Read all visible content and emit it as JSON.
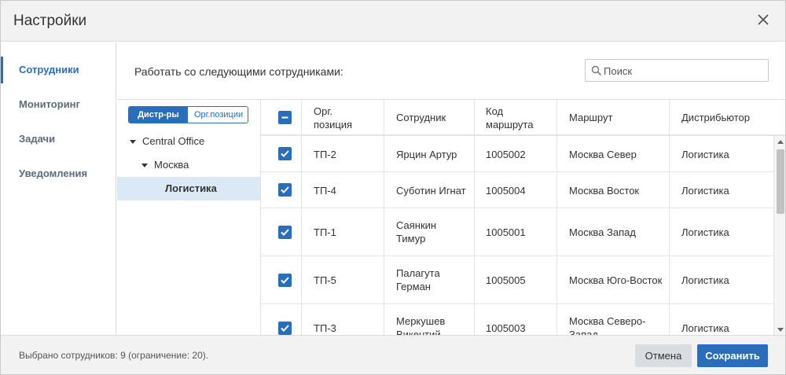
{
  "header": {
    "title": "Настройки"
  },
  "sidebar": {
    "items": [
      {
        "label": "Сотрудники",
        "active": true
      },
      {
        "label": "Мониторинг",
        "active": false
      },
      {
        "label": "Задачи",
        "active": false
      },
      {
        "label": "Уведомления",
        "active": false
      }
    ]
  },
  "main": {
    "prompt": "Работать со следующими сотрудниками:",
    "search": {
      "placeholder": "Поиск",
      "value": ""
    }
  },
  "tree": {
    "toggle": {
      "active_label": "Дистр-ры",
      "inactive_label": "Орг.позиции"
    },
    "nodes": [
      {
        "label": "Central Office"
      },
      {
        "label": "Москва"
      },
      {
        "label": "Логистика"
      }
    ]
  },
  "grid": {
    "columns": {
      "position": "Орг. позиция",
      "employee": "Сотрудник",
      "route_code": "Код маршрута",
      "route": "Маршрут",
      "distributor": "Дистрибьютор"
    },
    "rows": [
      {
        "checked": true,
        "position": "ТП-2",
        "employee": "Ярцин Артур",
        "route_code": "1005002",
        "route": "Москва Север",
        "distributor": "Логистика"
      },
      {
        "checked": true,
        "position": "ТП-4",
        "employee": "Суботин Игнат",
        "route_code": "1005004",
        "route": "Москва Восток",
        "distributor": "Логистика"
      },
      {
        "checked": true,
        "position": "ТП-1",
        "employee": "Саянкин Тимур",
        "route_code": "1005001",
        "route": "Москва Запад",
        "distributor": "Логистика"
      },
      {
        "checked": true,
        "position": "ТП-5",
        "employee": "Палагута Герман",
        "route_code": "1005005",
        "route": "Москва Юго-Восток",
        "distributor": "Логистика"
      },
      {
        "checked": true,
        "position": "ТП-3",
        "employee": "Меркушев Викентий",
        "route_code": "1005003",
        "route": "Москва Северо-Запад",
        "distributor": "Логистика"
      }
    ]
  },
  "footer": {
    "status": "Выбрано сотрудников: 9 (ограничение: 20).",
    "cancel_label": "Отмена",
    "save_label": "Сохранить"
  },
  "colors": {
    "accent": "#2a6ebb",
    "selected_row": "#dbe9f6",
    "header_bg": "#f2f2f2"
  }
}
